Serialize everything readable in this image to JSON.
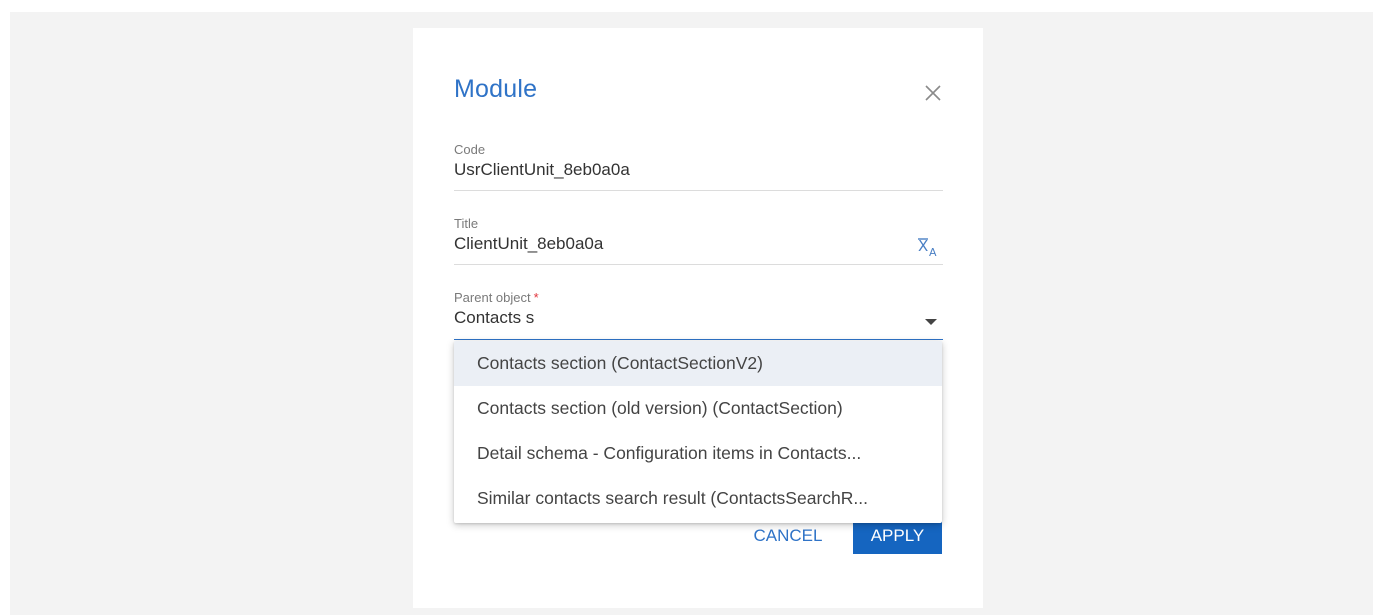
{
  "dialog": {
    "title": "Module"
  },
  "fields": {
    "code": {
      "label": "Code",
      "value": "UsrClientUnit_8eb0a0a"
    },
    "title": {
      "label": "Title",
      "value": "ClientUnit_8eb0a0a"
    },
    "parent": {
      "label": "Parent object",
      "required_mark": "*",
      "value": "Contacts s"
    }
  },
  "dropdown": {
    "options": [
      "Contacts section (ContactSectionV2)",
      "Contacts section (old version) (ContactSection)",
      "Detail schema - Configuration items in Contacts...",
      "Similar contacts search result (ContactsSearchR..."
    ],
    "highlighted_index": 0
  },
  "buttons": {
    "cancel": "CANCEL",
    "apply": "APPLY"
  },
  "icons": {
    "close": "close-icon",
    "translate": "translate-icon",
    "dropdown": "chevron-down-icon"
  },
  "colors": {
    "accent": "#2f73c7",
    "primary_button": "#1565c0",
    "required": "#e1343c",
    "highlight": "#ebeff5"
  }
}
